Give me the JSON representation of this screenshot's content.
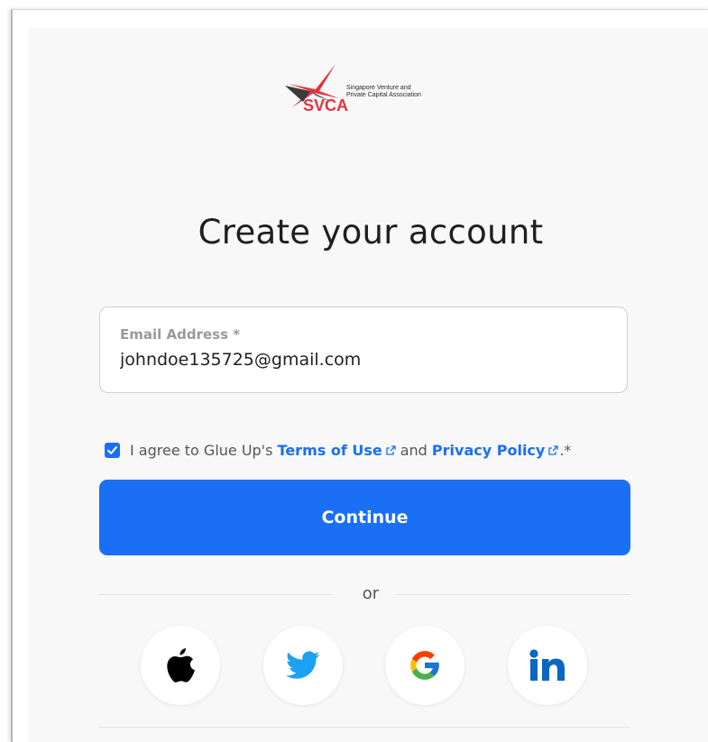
{
  "logo": {
    "acronym": "SVCA",
    "name_line1": "Singapore Venture and",
    "name_line2": "Private Capital Association",
    "brand_color": "#e8323c"
  },
  "title": "Create your account",
  "email": {
    "label": "Email Address *",
    "value": "johndoe135725@gmail.com"
  },
  "agreement": {
    "checked": true,
    "prefix": "I agree to Glue Up's",
    "terms_link": "Terms of Use",
    "conjunction": "and",
    "privacy_link": "Privacy Policy",
    "suffix": ".*"
  },
  "continue_label": "Continue",
  "divider_text": "or",
  "social": [
    {
      "icon": "apple-icon",
      "color": "#000000"
    },
    {
      "icon": "twitter-icon",
      "color": "#1da1f2"
    },
    {
      "icon": "google-icon",
      "color": "#4285f4"
    },
    {
      "icon": "linkedin-icon",
      "color": "#0a66c2"
    }
  ],
  "colors": {
    "accent": "#1a6ff5",
    "background": "#f8f8f8"
  }
}
